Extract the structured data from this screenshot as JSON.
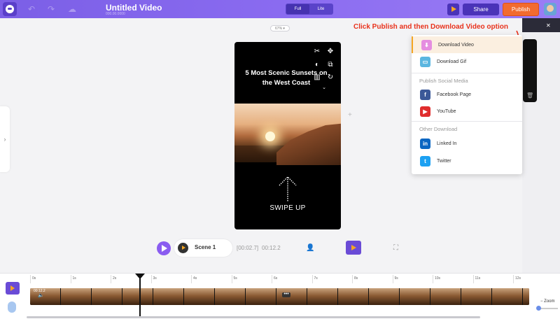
{
  "header": {
    "title": "Untitled Video",
    "subtitle": "000.00.0000",
    "toggle": [
      "Full",
      "Lite"
    ],
    "share_label": "Share",
    "publish_label": "Publish"
  },
  "canvas": {
    "zoom": "67%",
    "headline": "5 Most Scenic Sunsets on the West Coast",
    "swipe_text": "SWIPE UP"
  },
  "annotation": "Click Publish and then Download Video option",
  "dropdown": {
    "download_video": "Download Video",
    "download_gif": "Download Gif",
    "social_heading": "Publish Social Media",
    "facebook": "Facebook Page",
    "youtube": "YouTube",
    "other_heading": "Other Download",
    "linkedin": "Linked In",
    "twitter": "Twitter"
  },
  "playback": {
    "scene": "Scene 1",
    "current_time": "[00:02.7]",
    "total_time": "00:12.2"
  },
  "timeline": {
    "ticks": [
      "0s",
      "1s",
      "2s",
      "3s",
      "4s",
      "5s",
      "6s",
      "7s",
      "8s",
      "9s",
      "10s",
      "11s",
      "12s"
    ],
    "strip_label": "00:12.2",
    "zoom_label": "Zoom"
  },
  "colors": {
    "brand_purple": "#8a6bf0",
    "publish_orange": "#f26b2f",
    "annotation_red": "#e8321c",
    "highlight": "#f5a623"
  },
  "icons": {
    "cut": "scissors-icon",
    "move": "move-icon",
    "contrast": "contrast-icon",
    "layers": "layers-icon",
    "fade": "fade-icon",
    "rotate": "rotate-icon",
    "more": "chevron-down-icon"
  }
}
